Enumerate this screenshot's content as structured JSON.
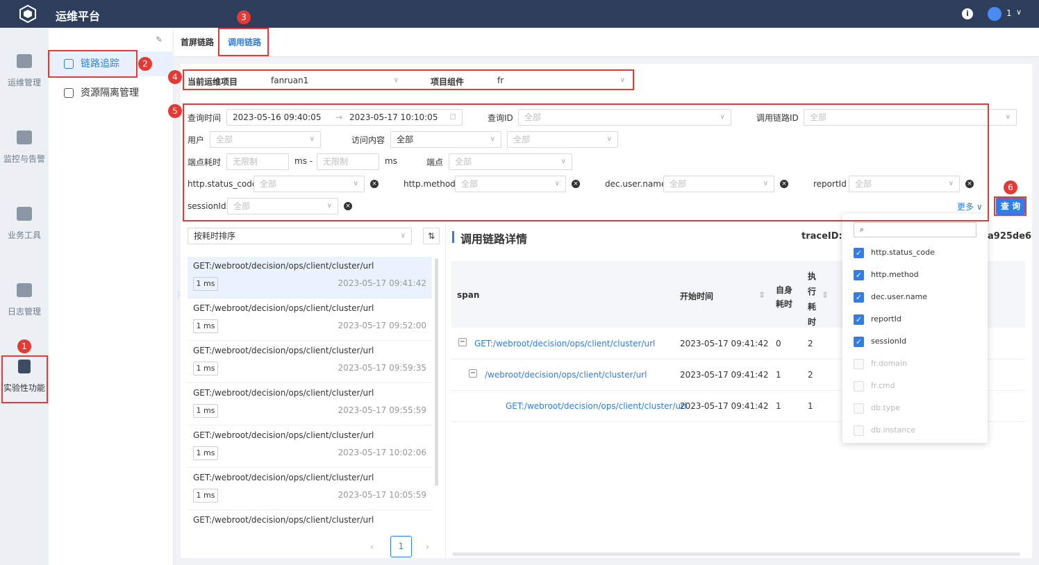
{
  "header": {
    "title": "运维平台",
    "info_icon": "i",
    "user": "1",
    "user_chevron": "∨"
  },
  "sidebar": {
    "items": [
      {
        "label": "运维管理"
      },
      {
        "label": "监控与告警"
      },
      {
        "label": "业务工具"
      },
      {
        "label": "日志管理"
      },
      {
        "label": "实验性功能"
      }
    ]
  },
  "subnav": {
    "items": [
      {
        "label": "链路追踪"
      },
      {
        "label": "资源隔离管理"
      }
    ]
  },
  "tabs": [
    {
      "label": "首屏链路"
    },
    {
      "label": "调用链路"
    }
  ],
  "badges": [
    "1",
    "2",
    "3",
    "4",
    "5",
    "6"
  ],
  "project": {
    "label": "当前运维项目",
    "value": "fanruan1",
    "component_label": "项目组件",
    "component_value": "fr"
  },
  "filters": {
    "query_time_label": "查询时间",
    "time_start": "2023-05-16 09:40:05",
    "time_sep": "→",
    "time_end": "2023-05-17 10:10:05",
    "query_id_label": "查询ID",
    "query_id_ph": "全部",
    "trace_id_label": "调用链路ID",
    "trace_id_ph": "全部",
    "user_label": "用户",
    "user_ph": "全部",
    "visit_label": "访问内容",
    "visit_ph": "全部",
    "visit2_ph": "全部",
    "ep_time_label": "端点耗时",
    "ep_min_ph": "无限制",
    "ms_dash": "ms -",
    "ep_max_ph": "无限制",
    "ms": "ms",
    "endpoint_label": "端点",
    "endpoint_ph": "全部",
    "status_code_label": "http.status_code",
    "status_code_ph": "全部",
    "method_label": "http.method",
    "method_ph": "全部",
    "user_name_label": "dec.user.name",
    "user_name_ph": "全部",
    "report_label": "reportId",
    "report_ph": "全部",
    "session_label": "sessionId",
    "session_ph": "全部",
    "more": "更多",
    "query_button": "查 询"
  },
  "list": {
    "sort": "按耗时排序",
    "items": [
      {
        "path": "GET:/webroot/decision/ops/client/cluster/url",
        "dur": "1 ms",
        "time": "2023-05-17 09:41:42"
      },
      {
        "path": "GET:/webroot/decision/ops/client/cluster/url",
        "dur": "1 ms",
        "time": "2023-05-17 09:52:00"
      },
      {
        "path": "GET:/webroot/decision/ops/client/cluster/url",
        "dur": "1 ms",
        "time": "2023-05-17 09:59:35"
      },
      {
        "path": "GET:/webroot/decision/ops/client/cluster/url",
        "dur": "1 ms",
        "time": "2023-05-17 09:55:59"
      },
      {
        "path": "GET:/webroot/decision/ops/client/cluster/url",
        "dur": "1 ms",
        "time": "2023-05-17 10:02:06"
      },
      {
        "path": "GET:/webroot/decision/ops/client/cluster/url",
        "dur": "1 ms",
        "time": "2023-05-17 10:05:59"
      },
      {
        "path": "GET:/webroot/decision/ops/client/cluster/url",
        "dur": "",
        "time": ""
      }
    ],
    "page": "1",
    "prev": "‹",
    "next": "›"
  },
  "detail": {
    "title": "调用链路详情",
    "trace_label": "traceID: e",
    "trace_tail": "a925de6",
    "headers": {
      "span": "span",
      "start": "开始时间",
      "self1": "自身",
      "self2": "耗时",
      "exec1": "执",
      "exec2": "行",
      "exec3": "耗",
      "exec4": "时"
    },
    "rows": [
      {
        "toggle": "−",
        "span": "GET:/webroot/decision/ops/client/cluster/url",
        "start": "2023-05-17 09:41:42",
        "self": "0",
        "exec": "2"
      },
      {
        "toggle": "−",
        "span": "/webroot/decision/ops/client/cluster/url",
        "start": "2023-05-17 09:41:42",
        "self": "1",
        "exec": "2"
      },
      {
        "toggle": "",
        "span": "GET:/webroot/decision/ops/client/cluster/url",
        "start": "2023-05-17 09:41:42",
        "self": "1",
        "exec": "1"
      }
    ]
  },
  "dropdown": {
    "options": [
      {
        "label": "http.status_code",
        "checked": true
      },
      {
        "label": "http.method",
        "checked": true
      },
      {
        "label": "dec.user.name",
        "checked": true
      },
      {
        "label": "reportId",
        "checked": true
      },
      {
        "label": "sessionId",
        "checked": true
      },
      {
        "label": "fr.domain",
        "checked": false
      },
      {
        "label": "fr.cmd",
        "checked": false
      },
      {
        "label": "db.type",
        "checked": false
      },
      {
        "label": "db.instance",
        "checked": false
      }
    ]
  }
}
